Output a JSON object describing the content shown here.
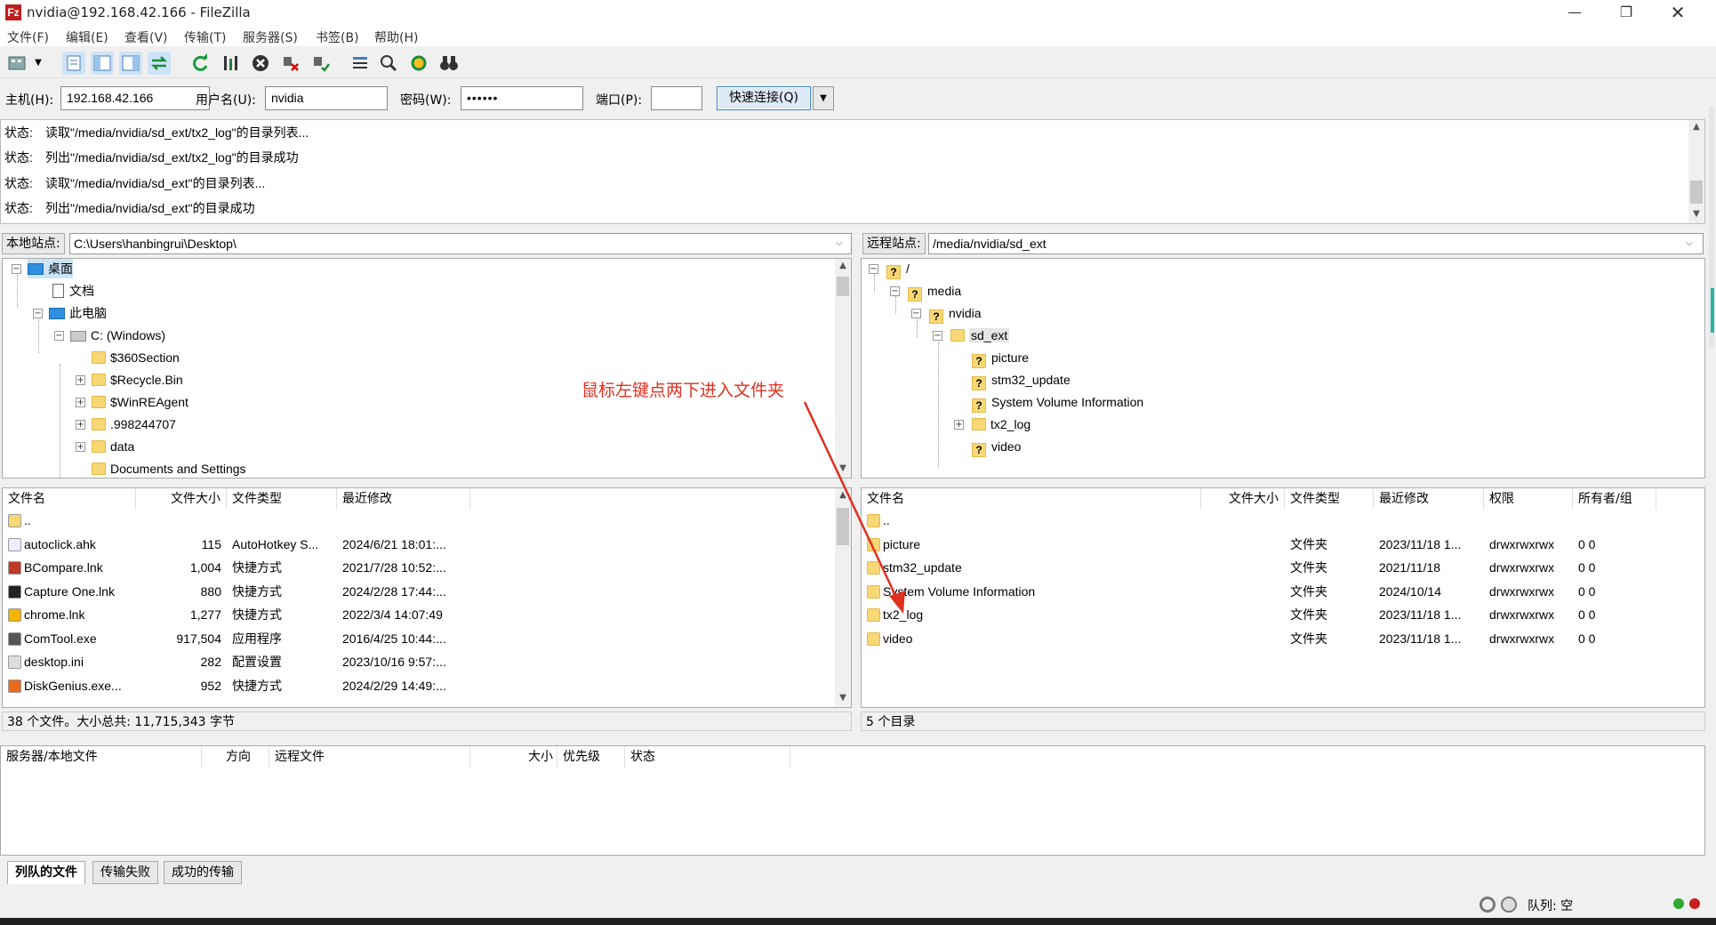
{
  "window": {
    "title": "nvidia@192.168.42.166 - FileZilla",
    "app_icon": "Fz"
  },
  "menu": [
    "文件(F)",
    "编辑(E)",
    "查看(V)",
    "传输(T)",
    "服务器(S)",
    "书签(B)",
    "帮助(H)"
  ],
  "quickconnect": {
    "host_label": "主机(H):",
    "host_value": "192.168.42.166",
    "user_label": "用户名(U):",
    "user_value": "nvidia",
    "pass_label": "密码(W):",
    "pass_value": "••••••",
    "port_label": "端口(P):",
    "port_value": "",
    "button": "快速连接(Q)"
  },
  "log": [
    {
      "status": "状态:",
      "text": "读取\"/media/nvidia/sd_ext/tx2_log\"的目录列表..."
    },
    {
      "status": "状态:",
      "text": "列出\"/media/nvidia/sd_ext/tx2_log\"的目录成功"
    },
    {
      "status": "状态:",
      "text": "读取\"/media/nvidia/sd_ext\"的目录列表..."
    },
    {
      "status": "状态:",
      "text": "列出\"/media/nvidia/sd_ext\"的目录成功"
    }
  ],
  "local": {
    "site_label": "本地站点:",
    "path": "C:\\Users\\hanbingrui\\Desktop\\",
    "tree": [
      {
        "label": "桌面",
        "kind": "pc"
      },
      {
        "label": "文档",
        "kind": "doc"
      },
      {
        "label": "此电脑",
        "kind": "pc"
      },
      {
        "label": "C: (Windows)",
        "kind": "drive"
      },
      {
        "label": "$360Section",
        "kind": "folder"
      },
      {
        "label": "$Recycle.Bin",
        "kind": "folder"
      },
      {
        "label": "$WinREAgent",
        "kind": "folder"
      },
      {
        "label": ".998244707",
        "kind": "folder"
      },
      {
        "label": "data",
        "kind": "folder"
      },
      {
        "label": "Documents and Settings",
        "kind": "folder"
      }
    ],
    "columns": [
      "文件名",
      "文件大小",
      "文件类型",
      "最近修改"
    ],
    "rows": [
      {
        "name": "..",
        "size": "",
        "type": "",
        "date": "",
        "icon": "folder"
      },
      {
        "name": "autoclick.ahk",
        "size": "115",
        "type": "AutoHotkey S...",
        "date": "2024/6/21 18:01:...",
        "icon": "ahk"
      },
      {
        "name": "BCompare.lnk",
        "size": "1,004",
        "type": "快捷方式",
        "date": "2021/7/28 10:52:...",
        "icon": "bc"
      },
      {
        "name": "Capture One.lnk",
        "size": "880",
        "type": "快捷方式",
        "date": "2024/2/28 17:44:...",
        "icon": "c1"
      },
      {
        "name": "chrome.lnk",
        "size": "1,277",
        "type": "快捷方式",
        "date": "2022/3/4 14:07:49",
        "icon": "chrome"
      },
      {
        "name": "ComTool.exe",
        "size": "917,504",
        "type": "应用程序",
        "date": "2016/4/25 10:44:...",
        "icon": "exe"
      },
      {
        "name": "desktop.ini",
        "size": "282",
        "type": "配置设置",
        "date": "2023/10/16 9:57:...",
        "icon": "ini"
      },
      {
        "name": "DiskGenius.exe...",
        "size": "952",
        "type": "快捷方式",
        "date": "2024/2/29 14:49:...",
        "icon": "dg"
      }
    ],
    "status": "38 个文件。大小总共: 11,715,343 字节"
  },
  "remote": {
    "site_label": "远程站点:",
    "path": "/media/nvidia/sd_ext",
    "tree": [
      {
        "label": "/"
      },
      {
        "label": "media"
      },
      {
        "label": "nvidia"
      },
      {
        "label": "sd_ext"
      },
      {
        "label": "picture"
      },
      {
        "label": "stm32_update"
      },
      {
        "label": "System Volume Information"
      },
      {
        "label": "tx2_log"
      },
      {
        "label": "video"
      }
    ],
    "columns": [
      "文件名",
      "文件大小",
      "文件类型",
      "最近修改",
      "权限",
      "所有者/组"
    ],
    "rows": [
      {
        "name": "..",
        "size": "",
        "type": "",
        "date": "",
        "perm": "",
        "owner": ""
      },
      {
        "name": "picture",
        "size": "",
        "type": "文件夹",
        "date": "2023/11/18 1...",
        "perm": "drwxrwxrwx",
        "owner": "0 0"
      },
      {
        "name": "stm32_update",
        "size": "",
        "type": "文件夹",
        "date": "2021/11/18",
        "perm": "drwxrwxrwx",
        "owner": "0 0"
      },
      {
        "name": "System Volume Information",
        "size": "",
        "type": "文件夹",
        "date": "2024/10/14",
        "perm": "drwxrwxrwx",
        "owner": "0 0"
      },
      {
        "name": "tx2_log",
        "size": "",
        "type": "文件夹",
        "date": "2023/11/18 1...",
        "perm": "drwxrwxrwx",
        "owner": "0 0"
      },
      {
        "name": "video",
        "size": "",
        "type": "文件夹",
        "date": "2023/11/18 1...",
        "perm": "drwxrwxrwx",
        "owner": "0 0"
      }
    ],
    "status": "5 个目录"
  },
  "queue": {
    "columns": [
      "服务器/本地文件",
      "方向",
      "远程文件",
      "大小",
      "优先级",
      "状态"
    ],
    "tabs": [
      "列队的文件",
      "传输失败",
      "成功的传输"
    ]
  },
  "statusbar": {
    "queue_text": "队列: 空"
  },
  "annotation": {
    "text": "鼠标左键点两下进入文件夹",
    "color": "#e03020"
  }
}
